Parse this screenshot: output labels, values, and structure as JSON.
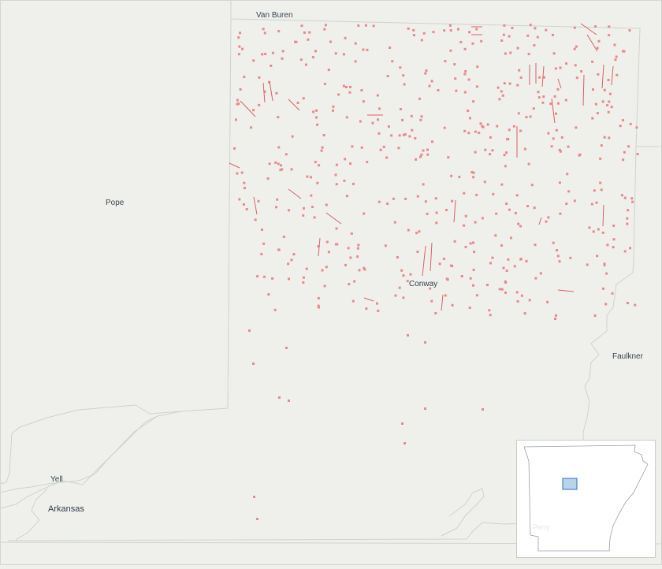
{
  "map": {
    "counties": [
      "Van Buren",
      "Pope",
      "Faulkner",
      "Yell",
      "Perry"
    ],
    "city": "Conway",
    "state": "Arkansas",
    "colors": {
      "background": "#eff0ec",
      "boundary": "#cfd2cd",
      "wells": "#e8898a",
      "wells_line": "#d9615f",
      "inset_fill": "#b8d4ea",
      "inset_stroke": "#2d6fbf"
    }
  },
  "labels": {
    "van_buren": "Van Buren",
    "pope": "Pope",
    "faulkner": "Faulkner",
    "yell": "Yell",
    "arkansas": "Arkansas",
    "conway": "Conway",
    "perry": "Perry"
  }
}
